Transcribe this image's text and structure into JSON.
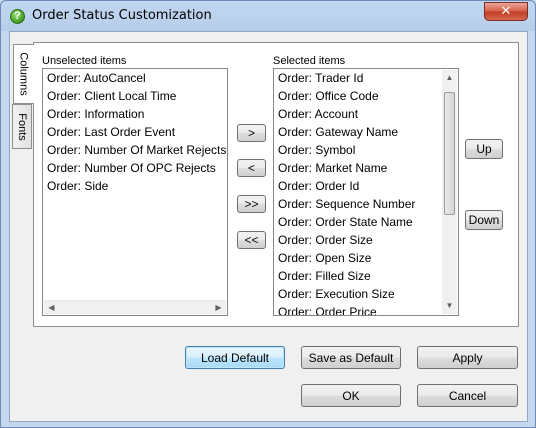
{
  "window": {
    "title": "Order Status Customization",
    "close_glyph": "✕"
  },
  "tabs": [
    {
      "label": "Columns",
      "active": true
    },
    {
      "label": "Fonts",
      "active": false
    }
  ],
  "unselected": {
    "label": "Unselected items",
    "items": [
      "Order: AutoCancel",
      "Order: Client Local Time",
      "Order: Information",
      "Order: Last Order Event",
      "Order: Number Of Market Rejects",
      "Order: Number Of OPC Rejects",
      "Order: Side"
    ]
  },
  "selected": {
    "label": "Selected items",
    "items": [
      "Order: Trader Id",
      "Order: Office Code",
      "Order: Account",
      "Order: Gateway Name",
      "Order: Symbol",
      "Order: Market Name",
      "Order: Order Id",
      "Order: Sequence Number",
      "Order: Order State Name",
      "Order: Order Size",
      "Order: Open Size",
      "Order: Filled Size",
      "Order: Execution Size",
      "Order: Order Price"
    ]
  },
  "transfer": {
    "add": ">",
    "remove": "<",
    "add_all": ">>",
    "remove_all": "<<"
  },
  "order_buttons": {
    "up": "Up",
    "down": "Down"
  },
  "footer": {
    "load_default": "Load Default",
    "save_default": "Save as Default",
    "apply": "Apply",
    "ok": "OK",
    "cancel": "Cancel"
  },
  "icons": {
    "app": "help-icon",
    "scroll_left": "◀",
    "scroll_right": "▶",
    "scroll_up": "▲",
    "scroll_down": "▼"
  }
}
